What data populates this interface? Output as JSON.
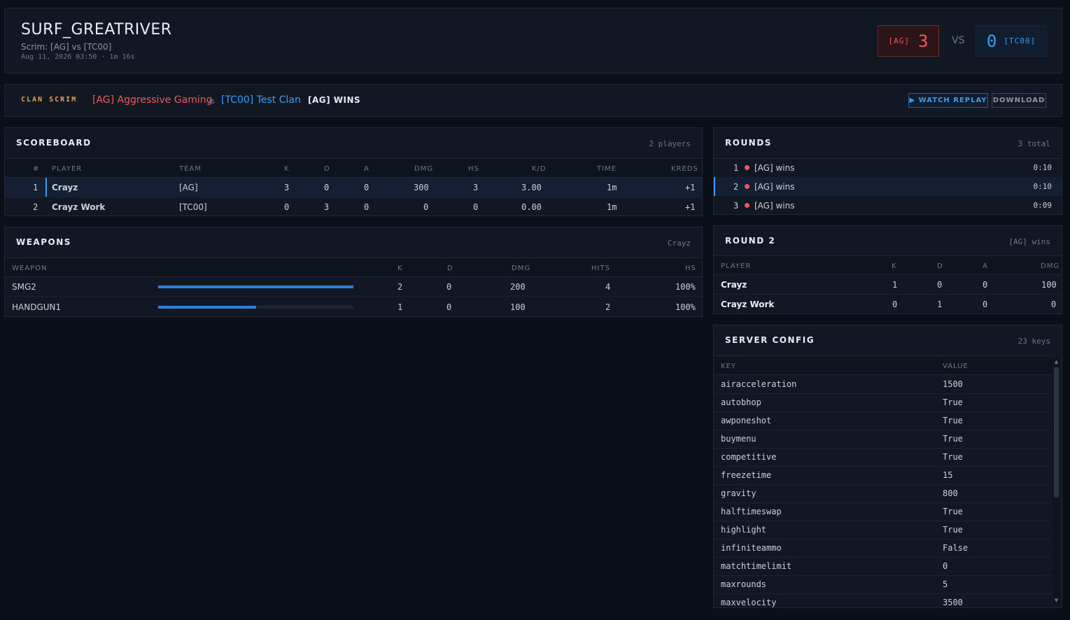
{
  "header": {
    "map": "SURF_GREATRIVER",
    "subtitle": "Scrim: [AG] vs [TC00]",
    "meta": "Aug 11, 2026 03:50 · 1m 16s",
    "team_a": {
      "tag": "[AG]",
      "score": "3",
      "color": "#f0575d"
    },
    "vs": "VS",
    "team_b": {
      "tag": "[TC00]",
      "score": "0",
      "color": "#3b9cf2"
    }
  },
  "clanbar": {
    "label": "CLAN SCRIM",
    "team_a": "[AG] Aggressive Gaming",
    "vs": "vs",
    "team_b": "[TC00] Test Clan",
    "result": "[AG] WINS",
    "watch_replay": "▶ WATCH REPLAY",
    "download": "DOWNLOAD"
  },
  "scoreboard": {
    "title": "SCOREBOARD",
    "meta": "2 players",
    "columns": [
      "#",
      "PLAYER",
      "TEAM",
      "K",
      "D",
      "A",
      "DMG",
      "HS",
      "K/D",
      "TIME",
      "KREDS"
    ],
    "rows": [
      {
        "num": "1",
        "player": "Crayz",
        "team": "[AG]",
        "k": "3",
        "d": "0",
        "a": "0",
        "dmg": "300",
        "hs": "3",
        "kd": "3.00",
        "time": "1m",
        "kreds": "+1"
      },
      {
        "num": "2",
        "player": "Crayz Work",
        "team": "[TC00]",
        "k": "0",
        "d": "3",
        "a": "0",
        "dmg": "0",
        "hs": "0",
        "kd": "0.00",
        "time": "1m",
        "kreds": "+1"
      }
    ]
  },
  "weapons": {
    "title": "WEAPONS",
    "meta": "Crayz",
    "columns": [
      "WEAPON",
      "K",
      "D",
      "DMG",
      "HITS",
      "HS"
    ],
    "rows": [
      {
        "weapon": "SMG2",
        "share": 1.0,
        "k": "2",
        "d": "0",
        "dmg": "200",
        "hits": "4",
        "hs": "100%"
      },
      {
        "weapon": "HANDGUN1",
        "share": 0.5,
        "k": "1",
        "d": "0",
        "dmg": "100",
        "hits": "2",
        "hs": "100%"
      }
    ]
  },
  "rounds": {
    "title": "ROUNDS",
    "meta": "3 total",
    "rows": [
      {
        "num": "1",
        "result": "[AG] wins",
        "time": "0:10"
      },
      {
        "num": "2",
        "result": "[AG] wins",
        "time": "0:10"
      },
      {
        "num": "3",
        "result": "[AG] wins",
        "time": "0:09"
      }
    ]
  },
  "round_detail": {
    "title": "ROUND 2",
    "meta": "[AG] wins",
    "columns": [
      "PLAYER",
      "K",
      "D",
      "A",
      "DMG"
    ],
    "rows": [
      {
        "player": "Crayz",
        "k": "1",
        "d": "0",
        "a": "0",
        "dmg": "100"
      },
      {
        "player": "Crayz Work",
        "k": "0",
        "d": "1",
        "a": "0",
        "dmg": "0"
      }
    ]
  },
  "config": {
    "title": "SERVER CONFIG",
    "meta": "23 keys",
    "columns": [
      "KEY",
      "VALUE"
    ],
    "rows": [
      {
        "key": "airacceleration",
        "value": "1500"
      },
      {
        "key": "autobhop",
        "value": "True"
      },
      {
        "key": "awponeshot",
        "value": "True"
      },
      {
        "key": "buymenu",
        "value": "True"
      },
      {
        "key": "competitive",
        "value": "True"
      },
      {
        "key": "freezetime",
        "value": "15"
      },
      {
        "key": "gravity",
        "value": "800"
      },
      {
        "key": "halftimeswap",
        "value": "True"
      },
      {
        "key": "highlight",
        "value": "True"
      },
      {
        "key": "infiniteammo",
        "value": "False"
      },
      {
        "key": "matchtimelimit",
        "value": "0"
      },
      {
        "key": "maxrounds",
        "value": "5"
      },
      {
        "key": "maxvelocity",
        "value": "3500"
      }
    ]
  }
}
